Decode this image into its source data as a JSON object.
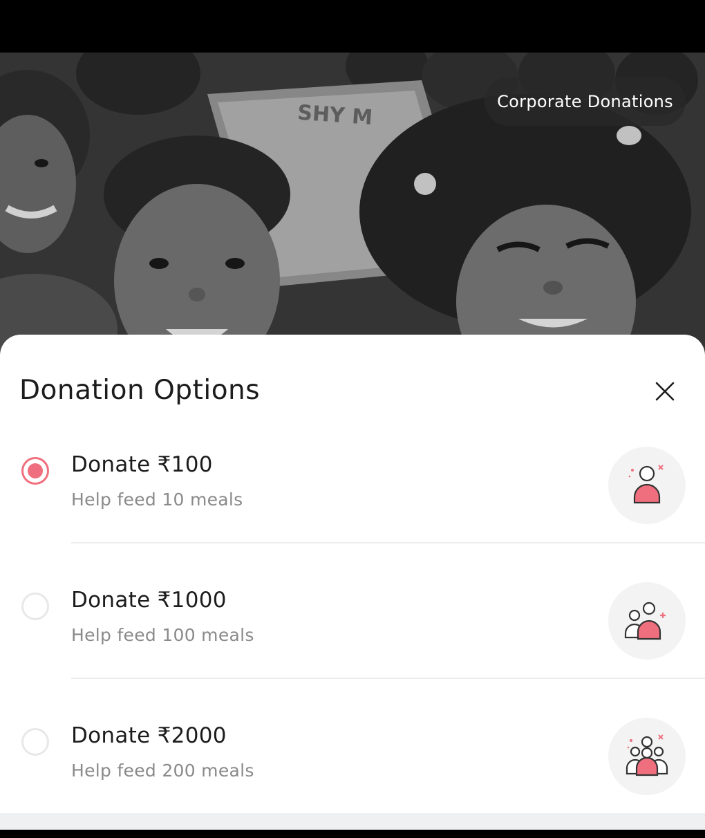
{
  "hero": {
    "corporate_label": "Corporate Donations",
    "sign_text": "SHY M"
  },
  "sheet": {
    "title": "Donation Options"
  },
  "options": [
    {
      "title": "Donate ₹100",
      "subtitle": "Help feed 10 meals",
      "selected": true,
      "icon": "single-person-icon"
    },
    {
      "title": "Donate ₹1000",
      "subtitle": "Help feed 100 meals",
      "selected": false,
      "icon": "two-people-icon"
    },
    {
      "title": "Donate ₹2000",
      "subtitle": "Help feed 200 meals",
      "selected": false,
      "icon": "group-people-icon"
    }
  ],
  "colors": {
    "accent": "#ef6f7e",
    "title_text": "#1c1c1c",
    "subtitle_text": "#8a8a8a",
    "icon_bg": "#f3f3f3"
  }
}
